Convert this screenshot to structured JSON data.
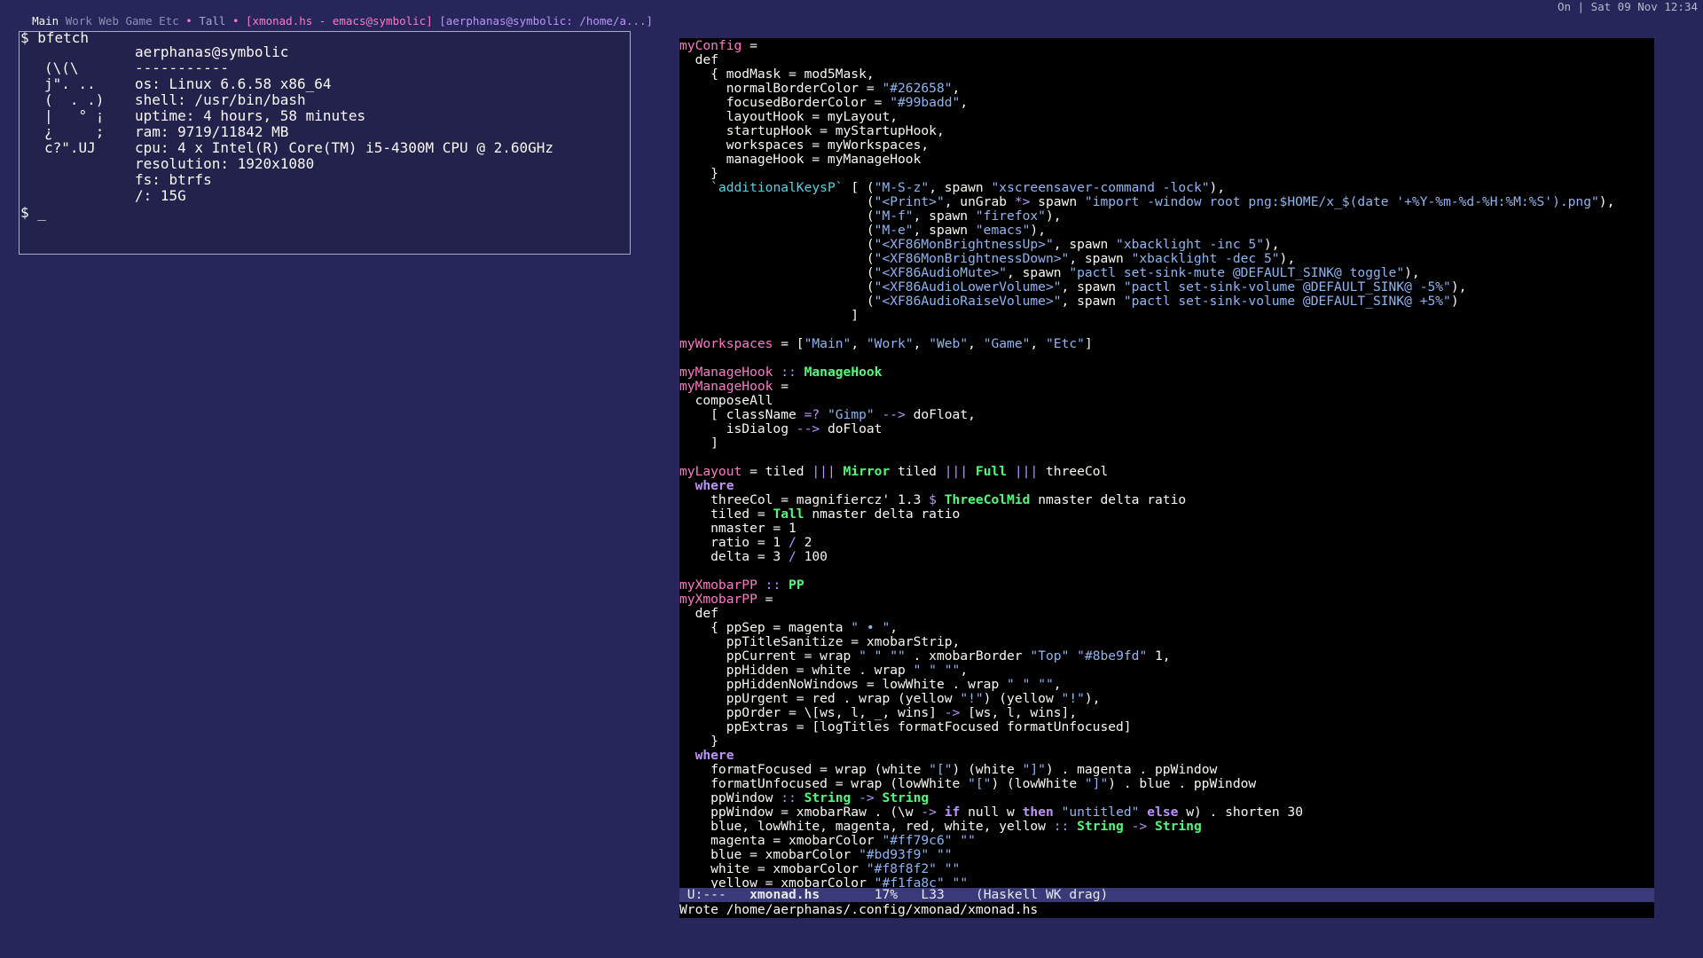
{
  "xmobar": {
    "workspaces": [
      "Main",
      "Work",
      "Web",
      "Game",
      "Etc"
    ],
    "current_workspace": "Main",
    "separator": "•",
    "layout": "Tall",
    "windows": [
      {
        "title": "[xmonad.hs - emacs@symbolic]",
        "focused": true
      },
      {
        "title": "[aerphanas@symbolic: /home/a...]",
        "focused": false
      }
    ],
    "status": "On | Sat 09 Nov 12:34"
  },
  "terminal": {
    "prompt_cmd": "$ bfetch",
    "ascii_art": [
      "(\\(\\",
      "j\". ..",
      "(  . .)",
      "|   ° ¡",
      "¿     ;",
      "c?\".UJ"
    ],
    "info": [
      "aerphanas@symbolic",
      "-----------",
      "os: Linux 6.6.58 x86_64",
      "shell: /usr/bin/bash",
      "uptime: 4 hours, 58 minutes",
      "ram: 9719/11842 MB",
      "cpu: 4 x Intel(R) Core(TM) i5-4300M CPU @ 2.60GHz",
      "resolution: 1920x1080",
      "fs: btrfs",
      "/: 15G"
    ],
    "prompt_end": "$ _"
  },
  "emacs": {
    "code_lines": [
      "myConfig =",
      "  def",
      "    { modMask = mod5Mask,",
      "      normalBorderColor = \"#262658\",",
      "      focusedBorderColor = \"#99badd\",",
      "      layoutHook = myLayout,",
      "      startupHook = myStartupHook,",
      "      workspaces = myWorkspaces,",
      "      manageHook = myManageHook",
      "    }",
      "    `additionalKeysP` [ (\"M-S-z\", spawn \"xscreensaver-command -lock\"),",
      "                        (\"<Print>\", unGrab *> spawn \"import -window root png:$HOME/x_$(date '+%Y-%m-%d-%H:%M:%S').png\"),",
      "                        (\"M-f\", spawn \"firefox\"),",
      "                        (\"M-e\", spawn \"emacs\"),",
      "                        (\"<XF86MonBrightnessUp>\", spawn \"xbacklight -inc 5\"),",
      "                        (\"<XF86MonBrightnessDown>\", spawn \"xbacklight -dec 5\"),",
      "                        (\"<XF86AudioMute>\", spawn \"pactl set-sink-mute @DEFAULT_SINK@ toggle\"),",
      "                        (\"<XF86AudioLowerVolume>\", spawn \"pactl set-sink-volume @DEFAULT_SINK@ -5%\"),",
      "                        (\"<XF86AudioRaiseVolume>\", spawn \"pactl set-sink-volume @DEFAULT_SINK@ +5%\")",
      "                      ]",
      "",
      "myWorkspaces = [\"Main\", \"Work\", \"Web\", \"Game\", \"Etc\"]",
      "",
      "myManageHook :: ManageHook",
      "myManageHook =",
      "  composeAll",
      "    [ className =? \"Gimp\" --> doFloat,",
      "      isDialog --> doFloat",
      "    ]",
      "",
      "myLayout = tiled ||| Mirror tiled ||| Full ||| threeCol",
      "  where",
      "    threeCol = magnifiercz' 1.3 $ ThreeColMid nmaster delta ratio",
      "    tiled = Tall nmaster delta ratio",
      "    nmaster = 1",
      "    ratio = 1 / 2",
      "    delta = 3 / 100",
      "",
      "myXmobarPP :: PP",
      "myXmobarPP =",
      "  def",
      "    { ppSep = magenta \" • \",",
      "      ppTitleSanitize = xmobarStrip,",
      "      ppCurrent = wrap \" \" \"\" . xmobarBorder \"Top\" \"#8be9fd\" 1,",
      "      ppHidden = white . wrap \" \" \"\",",
      "      ppHiddenNoWindows = lowWhite . wrap \" \" \"\",",
      "      ppUrgent = red . wrap (yellow \"!\") (yellow \"!\"),",
      "      ppOrder = \\[ws, l, _, wins] -> [ws, l, wins],",
      "      ppExtras = [logTitles formatFocused formatUnfocused]",
      "    }",
      "  where",
      "    formatFocused = wrap (white \"[\") (white \"]\") . magenta . ppWindow",
      "    formatUnfocused = wrap (lowWhite \"[\") (lowWhite \"]\") . blue . ppWindow",
      "    ppWindow :: String -> String",
      "    ppWindow = xmobarRaw . (\\w -> if null w then \"untitled\" else w) . shorten 30",
      "    blue, lowWhite, magenta, red, white, yellow :: String -> String",
      "    magenta = xmobarColor \"#ff79c6\" \"\"",
      "    blue = xmobarColor \"#bd93f9\" \"\"",
      "    white = xmobarColor \"#f8f8f2\" \"\"",
      "    yellow = xmobarColor \"#f1fa8c\" \"\""
    ],
    "modeline": {
      "status": "U:---",
      "buffer": "xmonad.hs",
      "percent": "17%",
      "line": "L33",
      "modes": "(Haskell WK drag)"
    },
    "echo": "Wrote /home/aerphanas/.config/xmonad/xmonad.hs"
  },
  "colors": {
    "desktop": "#26265a",
    "magenta": "#ff79c6",
    "string": "#8fb4f0",
    "type": "#50fa7b",
    "keyword": "#bd93f9",
    "modeline": "#3a3a7a"
  }
}
